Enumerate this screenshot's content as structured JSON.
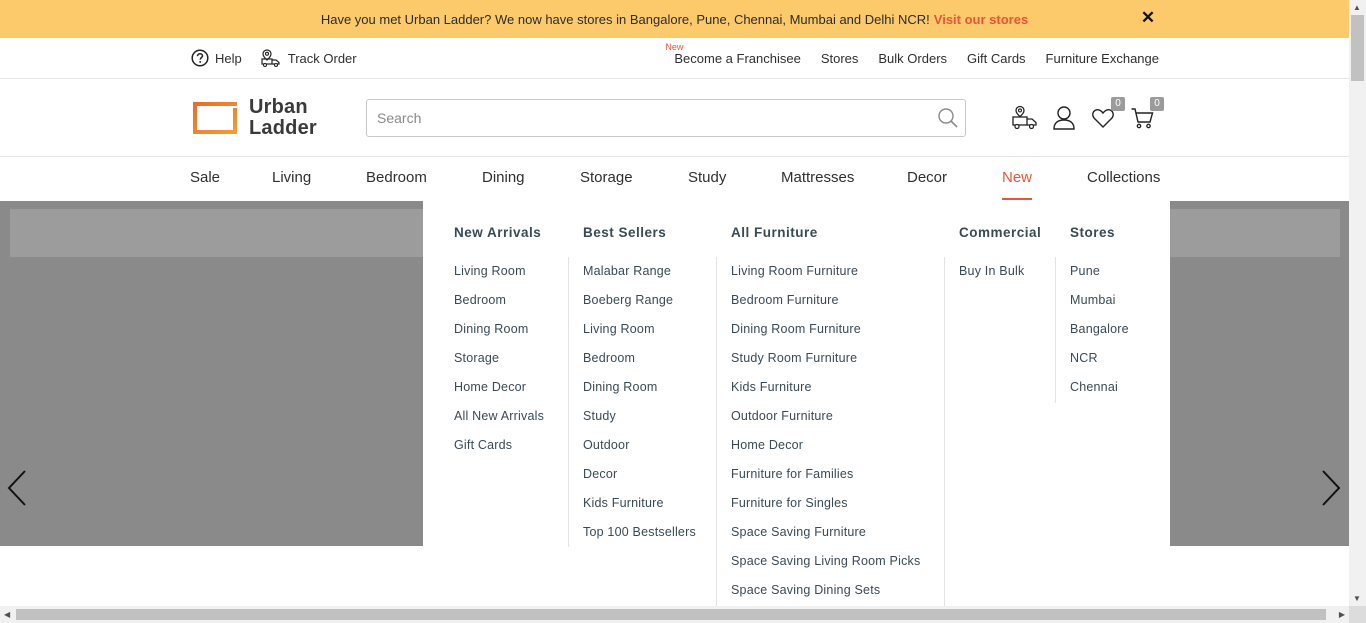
{
  "announcement": {
    "text": "Have you met Urban Ladder? We now have stores in Bangalore, Pune, Chennai, Mumbai and Delhi NCR!",
    "link": "Visit our stores",
    "close": "✕"
  },
  "util_bar": {
    "help": "Help",
    "track_order": "Track Order",
    "new_tag": "New",
    "links": [
      "Become a Franchisee",
      "Stores",
      "Bulk Orders",
      "Gift Cards",
      "Furniture Exchange"
    ]
  },
  "header": {
    "logo_line1": "Urban",
    "logo_line2": "Ladder",
    "search_placeholder": "Search",
    "wishlist_count": "0",
    "cart_count": "0"
  },
  "nav": [
    "Sale",
    "Living",
    "Bedroom",
    "Dining",
    "Storage",
    "Study",
    "Mattresses",
    "Decor",
    "New",
    "Collections"
  ],
  "mega_menu": {
    "columns": [
      {
        "heading": "New Arrivals",
        "links": [
          "Living Room",
          "Bedroom",
          "Dining Room",
          "Storage",
          "Home Decor",
          "All New Arrivals",
          "Gift Cards"
        ]
      },
      {
        "heading": "Best Sellers",
        "links": [
          "Malabar Range",
          "Boeberg Range",
          "Living Room",
          "Bedroom",
          "Dining Room",
          "Study",
          "Outdoor",
          "Decor",
          "Kids Furniture",
          "Top 100 Bestsellers"
        ]
      },
      {
        "heading": "All Furniture",
        "links": [
          "Living Room Furniture",
          "Bedroom Furniture",
          "Dining Room Furniture",
          "Study Room Furniture",
          "Kids Furniture",
          "Outdoor Furniture",
          "Home Decor",
          "Furniture for Families",
          "Furniture for Singles",
          "Space Saving Furniture",
          "Space Saving Living Room Picks",
          "Space Saving Dining Sets"
        ]
      },
      {
        "heading": "Commercial",
        "links": [
          "Buy In Bulk"
        ]
      },
      {
        "heading": "Stores",
        "links": [
          "Pune",
          "Mumbai",
          "Bangalore",
          "NCR",
          "Chennai"
        ]
      }
    ]
  },
  "colors": {
    "announcement_bg": "#fcca6b",
    "accent": "#e8553a",
    "hero_bg": "#8a8a8a"
  }
}
